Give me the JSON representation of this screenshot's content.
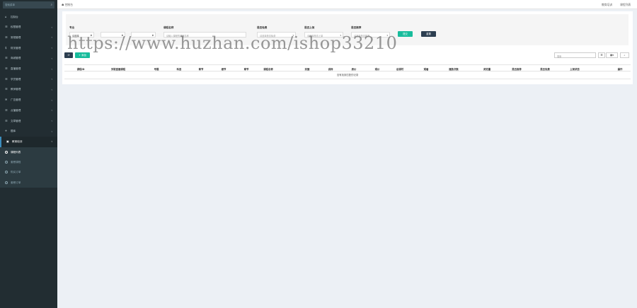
{
  "sidebar": {
    "search_placeholder": "搜索菜单",
    "items": [
      {
        "icon": "⌂",
        "label": "控制台",
        "arrow": ""
      },
      {
        "icon": "☰",
        "label": "权限管理",
        "arrow": "‹"
      },
      {
        "icon": "☰",
        "label": "常规管理",
        "arrow": "‹"
      },
      {
        "icon": "$",
        "label": "财务管理",
        "arrow": "‹"
      },
      {
        "icon": "☰",
        "label": "商城管理",
        "arrow": "‹"
      },
      {
        "icon": "☰",
        "label": "直播管理",
        "arrow": "‹"
      },
      {
        "icon": "☰",
        "label": "学员管理",
        "arrow": "‹"
      },
      {
        "icon": "☰",
        "label": "教师管理",
        "arrow": "‹"
      },
      {
        "icon": "✉",
        "label": "广告管理",
        "arrow": "‹"
      },
      {
        "icon": "☰",
        "label": "点播管理",
        "arrow": "‹"
      },
      {
        "icon": "☰",
        "label": "文章管理",
        "arrow": "‹"
      },
      {
        "icon": "✈",
        "label": "题库",
        "arrow": "‹"
      },
      {
        "icon": "▣",
        "label": "教育培训",
        "arrow": "‹"
      }
    ],
    "subitems": [
      {
        "label": "课程列表"
      },
      {
        "label": "套餐课程"
      },
      {
        "label": "购买订单"
      },
      {
        "label": "套餐订单"
      }
    ]
  },
  "topbar": {
    "home": "☗ 控制台",
    "link1": "教育培训",
    "link2": "课程列表"
  },
  "filter": {
    "labels": {
      "major": "专业",
      "course_name": "课程名称",
      "is_free": "是否免费",
      "is_on": "是否上架",
      "is_recommend": "是否推荐"
    },
    "major_select": "请选择",
    "name_placeholder": "请输入课程的课程名称",
    "is_free_placeholder": "请选择是否免费",
    "is_on_placeholder": "请选择是否上架",
    "is_recommend_placeholder": "请选择是否推荐",
    "submit": "提交",
    "reset": "重置"
  },
  "toolbar": {
    "refresh": "⟳",
    "add": "+ 添加",
    "search_placeholder": "搜索"
  },
  "table": {
    "headers": [
      "课程ID",
      "关联直播课程",
      "专题",
      "科目",
      "章节",
      "细节",
      "章节",
      "课程名称",
      "封面",
      "讲师",
      "原价",
      "现价",
      "总课时",
      "观看",
      "播放次数",
      "浏览量",
      "是否推荐",
      "是否免费",
      "上架状态",
      "操作"
    ],
    "empty_text": "没有找到匹配的记录"
  },
  "watermark": "https://www.huzhan.com/ishop33210",
  "colors": {
    "sidebar": "#222d32",
    "submit": "#18bc9c",
    "reset": "#2c3e50",
    "add": "#18bc9c",
    "refresh": "#2c3e50"
  }
}
